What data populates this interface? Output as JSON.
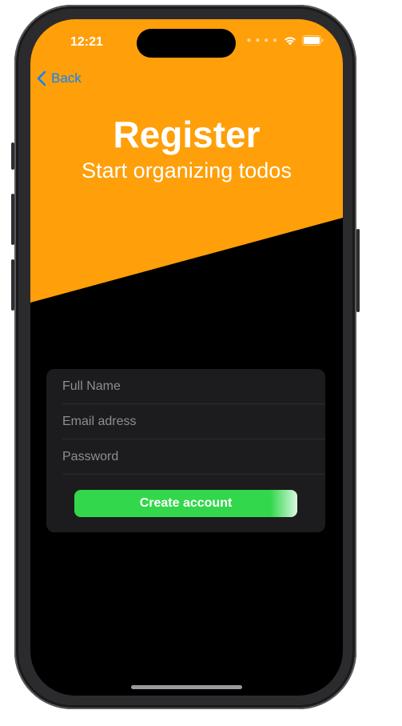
{
  "status_bar": {
    "time": "12:21",
    "icons": [
      "cellular-dots-icon",
      "wifi-icon",
      "battery-icon"
    ]
  },
  "nav": {
    "back_label": "Back",
    "back_icon": "chevron-left-icon"
  },
  "header": {
    "title": "Register",
    "subtitle": "Start organizing todos",
    "background_color": "#ff9f0a"
  },
  "form": {
    "full_name": {
      "placeholder": "Full Name",
      "value": ""
    },
    "email": {
      "placeholder": "Email adress",
      "value": ""
    },
    "password": {
      "placeholder": "Password",
      "value": ""
    },
    "submit_label": "Create account",
    "submit_color": "#32d74b"
  },
  "colors": {
    "accent": "#0a84ff",
    "screen_background": "#000000",
    "form_background": "#1c1c1e"
  }
}
